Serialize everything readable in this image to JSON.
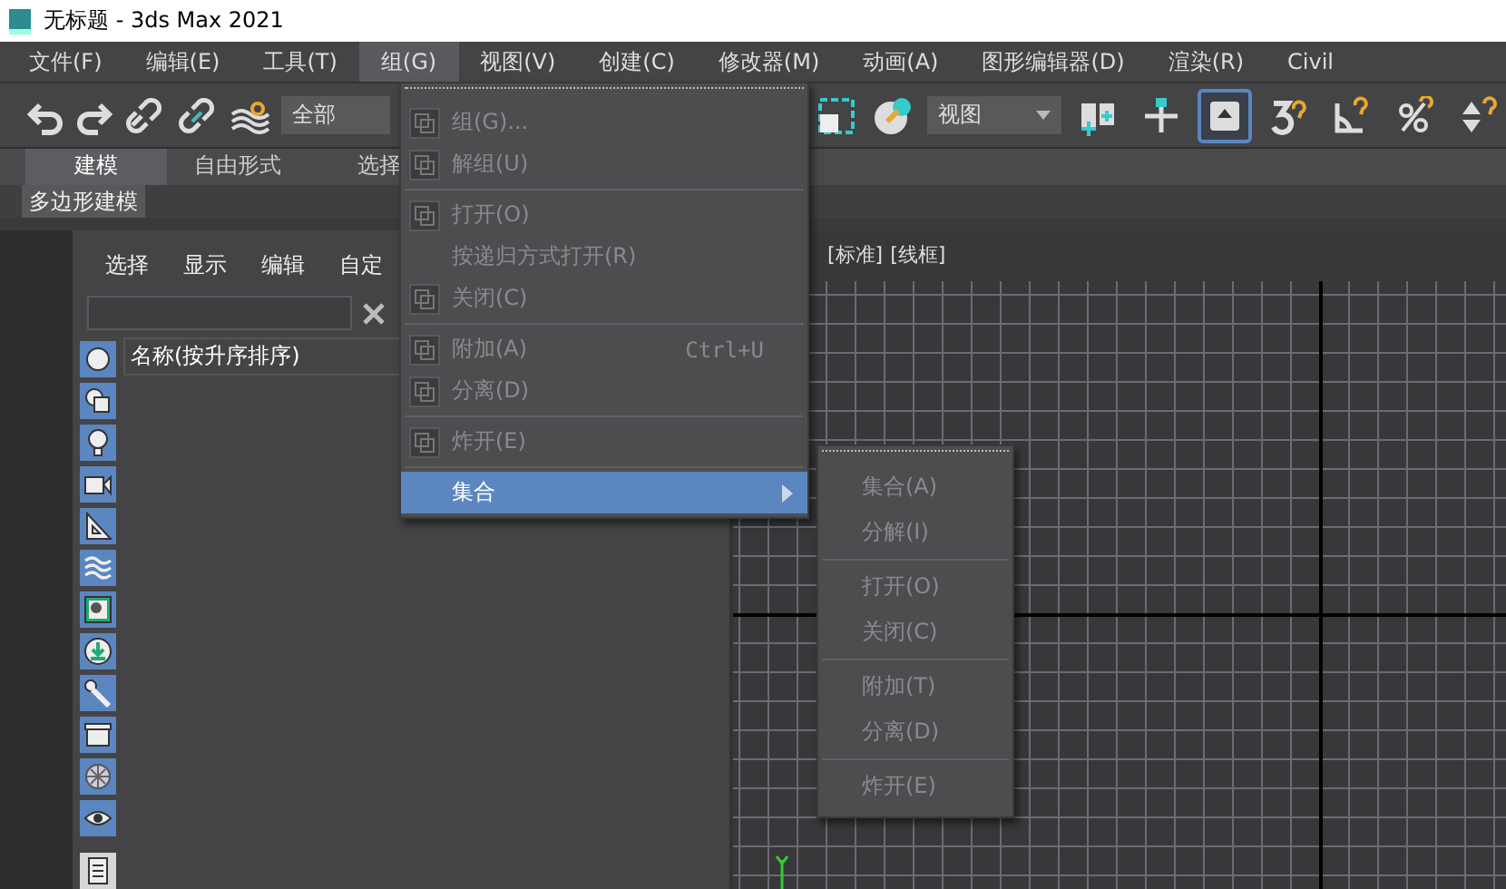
{
  "window": {
    "title": "无标题 - 3ds Max 2021"
  },
  "menu_bar": [
    {
      "label": "文件(F)",
      "selected": false
    },
    {
      "label": "编辑(E)",
      "selected": false
    },
    {
      "label": "工具(T)",
      "selected": false
    },
    {
      "label": "组(G)",
      "selected": true
    },
    {
      "label": "视图(V)",
      "selected": false
    },
    {
      "label": "创建(C)",
      "selected": false
    },
    {
      "label": "修改器(M)",
      "selected": false
    },
    {
      "label": "动画(A)",
      "selected": false
    },
    {
      "label": "图形编辑器(D)",
      "selected": false
    },
    {
      "label": "渲染(R)",
      "selected": false
    },
    {
      "label": "Civil",
      "selected": false
    }
  ],
  "toolbar": {
    "selection_filter": "全部",
    "reference_coordinate": "视图",
    "buttons": [
      {
        "selected": false
      },
      {
        "selected": false
      },
      {
        "selected": true
      },
      {
        "selected": false
      },
      {
        "selected": false
      },
      {
        "selected": false
      },
      {
        "selected": false
      }
    ]
  },
  "ribbon": {
    "tabs": [
      {
        "label": "建模",
        "selected": true
      },
      {
        "label": "自由形式",
        "selected": false
      },
      {
        "label": "选择",
        "selected": false
      }
    ],
    "panel_button": "多边形建模"
  },
  "scene_explorer": {
    "menu": [
      "选择",
      "显示",
      "编辑",
      "自定"
    ],
    "column_header": "名称(按升序排序)",
    "filters": [
      {
        "on": true
      },
      {
        "on": true
      },
      {
        "on": true
      },
      {
        "on": true
      },
      {
        "on": true
      },
      {
        "on": true
      },
      {
        "on": true
      },
      {
        "on": true
      },
      {
        "on": true
      },
      {
        "on": true
      },
      {
        "on": true
      },
      {
        "on": true
      },
      {
        "on": false
      }
    ]
  },
  "viewport": {
    "labels": [
      "[标准]",
      "[线框]"
    ]
  },
  "group_menu": [
    {
      "kind": "item",
      "label": "组(G)...",
      "icon": true,
      "disabled": true,
      "selected": false
    },
    {
      "kind": "item",
      "label": "解组(U)",
      "icon": true,
      "disabled": true,
      "selected": false
    },
    {
      "kind": "separator"
    },
    {
      "kind": "item",
      "label": "打开(O)",
      "icon": true,
      "disabled": true,
      "selected": false
    },
    {
      "kind": "item",
      "label": "按递归方式打开(R)",
      "icon": false,
      "disabled": true,
      "selected": false
    },
    {
      "kind": "item",
      "label": "关闭(C)",
      "icon": true,
      "disabled": true,
      "selected": false
    },
    {
      "kind": "separator"
    },
    {
      "kind": "item",
      "label": "附加(A)",
      "shortcut": "Ctrl+U",
      "icon": true,
      "disabled": true,
      "selected": false
    },
    {
      "kind": "item",
      "label": "分离(D)",
      "icon": true,
      "disabled": true,
      "selected": false
    },
    {
      "kind": "separator"
    },
    {
      "kind": "item",
      "label": "炸开(E)",
      "icon": true,
      "disabled": true,
      "selected": false
    },
    {
      "kind": "separator"
    },
    {
      "kind": "submenu",
      "label": "集合",
      "icon": false,
      "disabled": false,
      "selected": true
    }
  ],
  "submenu": [
    {
      "kind": "item",
      "label": "集合(A)",
      "disabled": true
    },
    {
      "kind": "item",
      "label": "分解(I)",
      "disabled": true
    },
    {
      "kind": "separator"
    },
    {
      "kind": "item",
      "label": "打开(O)",
      "disabled": true
    },
    {
      "kind": "item",
      "label": "关闭(C)",
      "disabled": true
    },
    {
      "kind": "separator"
    },
    {
      "kind": "item",
      "label": "附加(T)",
      "disabled": true
    },
    {
      "kind": "item",
      "label": "分离(D)",
      "disabled": true
    },
    {
      "kind": "separator"
    },
    {
      "kind": "item",
      "label": "炸开(E)",
      "disabled": true
    }
  ]
}
